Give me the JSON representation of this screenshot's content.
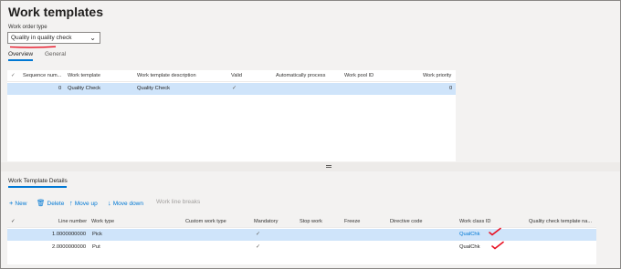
{
  "page": {
    "title": "Work templates"
  },
  "work_order_type": {
    "label": "Work order type",
    "value": "Quality in quality check"
  },
  "tabs": [
    {
      "label": "Overview",
      "active": true
    },
    {
      "label": "General",
      "active": false
    }
  ],
  "templates_grid": {
    "columns": [
      "Sequence num...",
      "Work template",
      "Work template description",
      "Valid",
      "Automatically process",
      "Work pool ID",
      "Work priority"
    ],
    "rows": [
      {
        "sequence": "0",
        "work_template": "Quality Check",
        "description": "Quality Check",
        "valid": "✓",
        "auto_process": "",
        "work_pool_id": "",
        "priority": "0"
      }
    ]
  },
  "details": {
    "title": "Work Template Details",
    "toolbar": {
      "new_label": "New",
      "delete_label": "Delete",
      "move_up_label": "Move up",
      "move_down_label": "Move down",
      "work_line_breaks_label": "Work line breaks"
    },
    "columns": [
      "Line number",
      "Work type",
      "Custom work type",
      "Mandatory",
      "Stop work",
      "Freeze",
      "Directive code",
      "Work class ID",
      "Quality check template na..."
    ],
    "rows": [
      {
        "line_number": "1.0000000000",
        "work_type": "Pick",
        "custom_work_type": "",
        "mandatory": "✓",
        "stop_work": "",
        "freeze": "",
        "directive_code": "",
        "work_class_id": "QualChk",
        "qc_template": ""
      },
      {
        "line_number": "2.0000000000",
        "work_type": "Put",
        "custom_work_type": "",
        "mandatory": "✓",
        "stop_work": "",
        "freeze": "",
        "directive_code": "",
        "work_class_id": "QualChk",
        "qc_template": ""
      }
    ]
  },
  "colors": {
    "accent": "#0078d4",
    "selected_row": "#cfe4fa",
    "annotation_red": "#e81123"
  }
}
